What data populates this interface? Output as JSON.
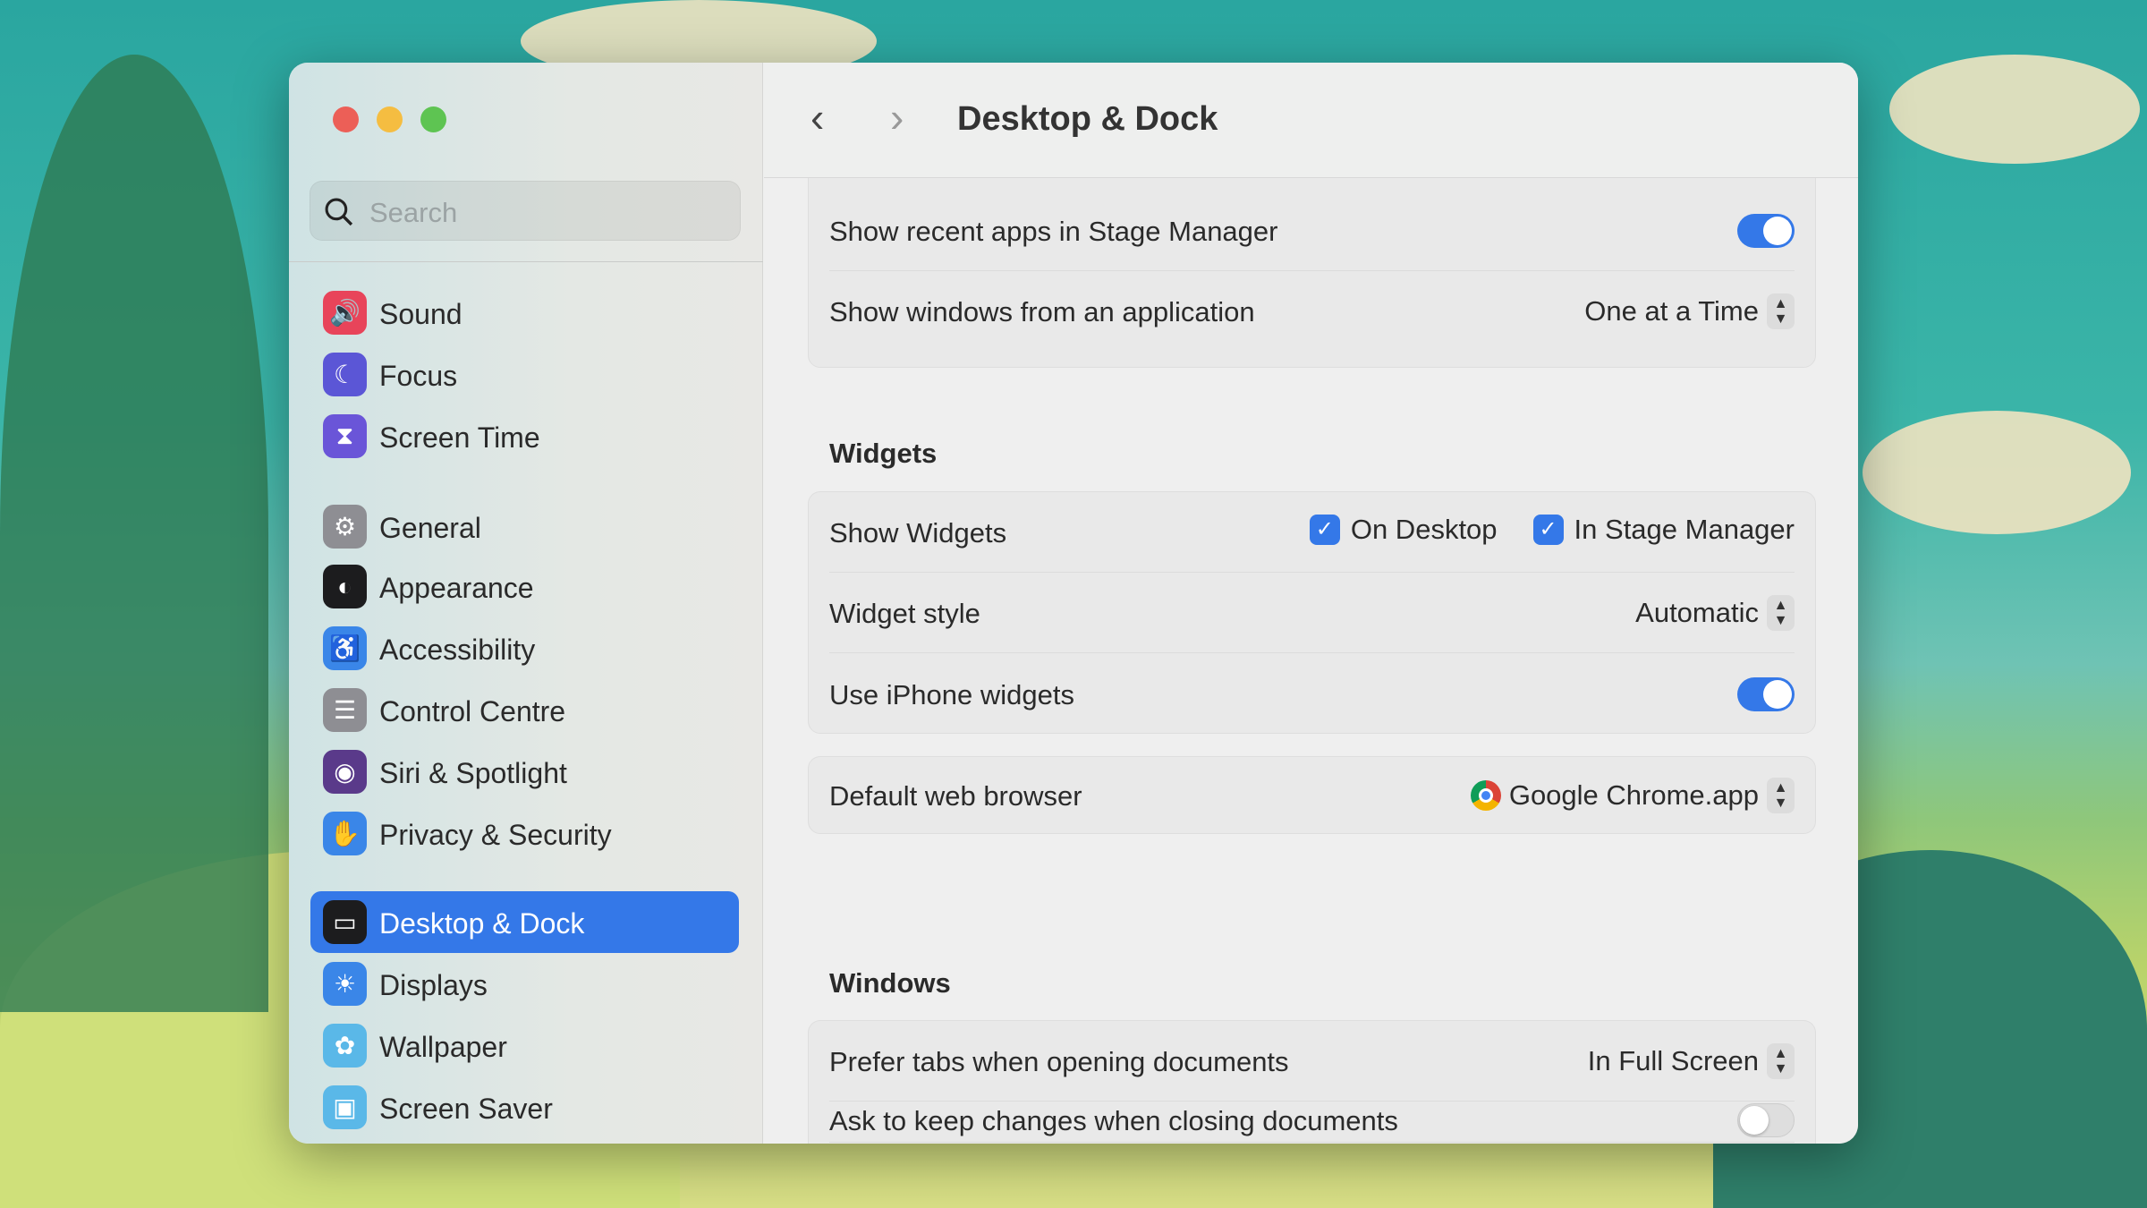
{
  "window": {
    "title": "Desktop & Dock"
  },
  "search": {
    "placeholder": "Search"
  },
  "sidebar": {
    "items": [
      {
        "label": "Sound",
        "icon": "speaker-icon",
        "color": "#e8445a"
      },
      {
        "label": "Focus",
        "icon": "moon-icon",
        "color": "#5b56d6"
      },
      {
        "label": "Screen Time",
        "icon": "hourglass-icon",
        "color": "#6a55d8"
      },
      {
        "label": "General",
        "icon": "gear-icon",
        "color": "#8e8e93"
      },
      {
        "label": "Appearance",
        "icon": "appearance-icon",
        "color": "#1c1c1e"
      },
      {
        "label": "Accessibility",
        "icon": "accessibility-icon",
        "color": "#3a86e8"
      },
      {
        "label": "Control Centre",
        "icon": "switches-icon",
        "color": "#8e8e93"
      },
      {
        "label": "Siri & Spotlight",
        "icon": "siri-icon",
        "color": "#5a3a8a"
      },
      {
        "label": "Privacy & Security",
        "icon": "hand-icon",
        "color": "#3a86e8"
      },
      {
        "label": "Desktop & Dock",
        "icon": "dock-icon",
        "color": "#1c1c1e"
      },
      {
        "label": "Displays",
        "icon": "sun-icon",
        "color": "#3a86e8"
      },
      {
        "label": "Wallpaper",
        "icon": "flower-icon",
        "color": "#5ab8e8"
      },
      {
        "label": "Screen Saver",
        "icon": "screensaver-icon",
        "color": "#5ab8e8"
      }
    ]
  },
  "stage": {
    "recent_apps": "Show recent apps in Stage Manager",
    "recent_apps_on": true,
    "show_windows": "Show windows from an application",
    "show_windows_value": "One at a Time"
  },
  "widgets": {
    "heading": "Widgets",
    "show": "Show Widgets",
    "on_desktop": "On Desktop",
    "in_stage": "In Stage Manager",
    "style": "Widget style",
    "style_value": "Automatic",
    "iphone": "Use iPhone widgets",
    "iphone_on": true
  },
  "browser": {
    "label": "Default web browser",
    "value": "Google Chrome.app"
  },
  "windows": {
    "heading": "Windows",
    "prefer_tabs": "Prefer tabs when opening documents",
    "prefer_tabs_value": "In Full Screen",
    "ask_keep": "Ask to keep changes when closing documents",
    "ask_keep_on": false
  },
  "stepper_glyph": "⌃⌄"
}
